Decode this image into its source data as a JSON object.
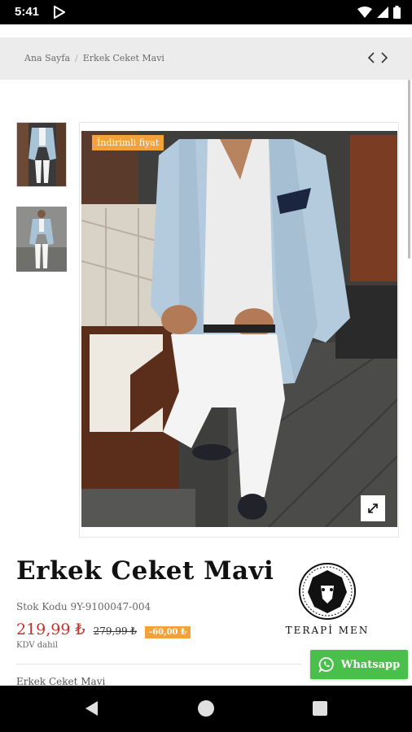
{
  "status_bar": {
    "time": "5:41",
    "icons": [
      "play-store-icon",
      "wifi-icon",
      "signal-icon",
      "battery-icon"
    ]
  },
  "breadcrumb": {
    "home": "Ana Sayfa",
    "current": "Erkek Ceket Mavi"
  },
  "gallery": {
    "badge": "İndirimli fiyat",
    "zoom_icon": "expand-icon",
    "thumbnails": 2
  },
  "product": {
    "title": "Erkek Ceket Mavi",
    "stock_code": "Stok Kodu 9Y-9100047-004",
    "price": "219,99 ₺",
    "old_price": "279,99 ₺",
    "discount": "-60,00 ₺",
    "tax_note": "KDV dahil",
    "section_label": "Erkek Ceket Mavi"
  },
  "brand": {
    "name": "TERAPİ MEN"
  },
  "whatsapp": {
    "label": "Whatsapp"
  },
  "colors": {
    "price": "#c8302b",
    "badge": "#f2a23a",
    "whatsapp": "#4bbf4b"
  }
}
